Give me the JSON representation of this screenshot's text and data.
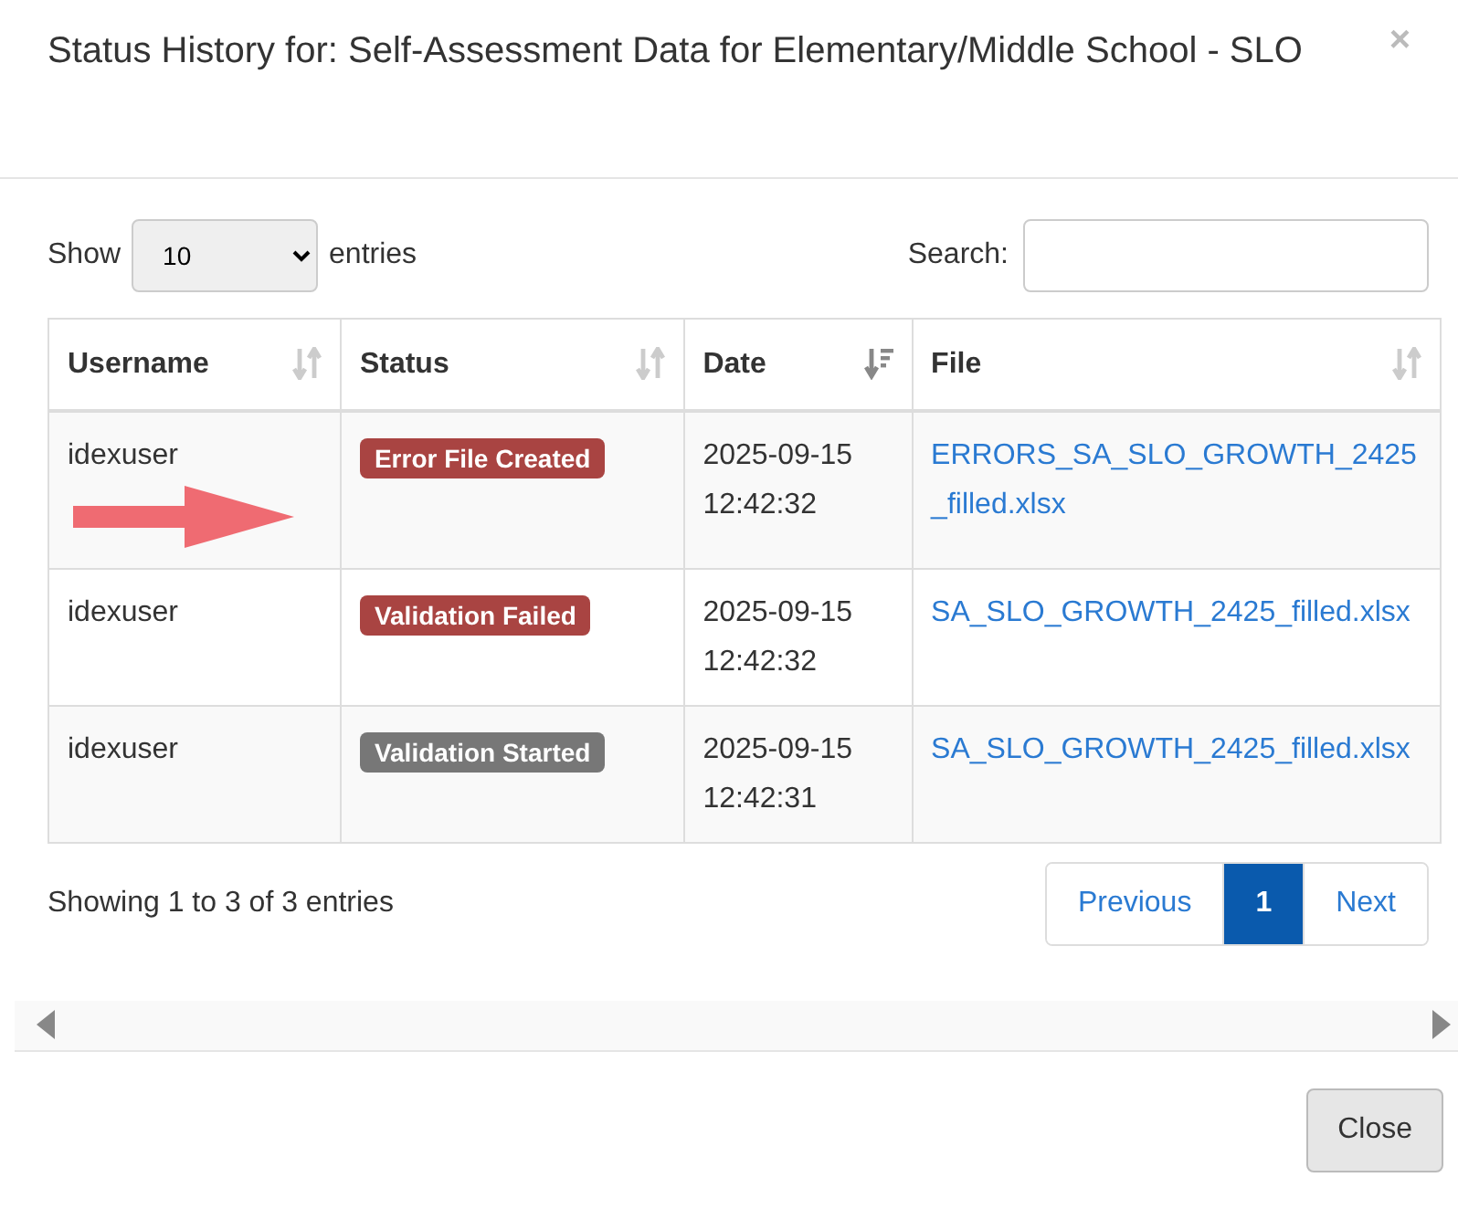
{
  "dialog": {
    "title": "Status History for: Self-Assessment Data for Elementary/Middle School - SLO",
    "close_glyph": "×"
  },
  "length": {
    "label_before": "Show",
    "value": "10",
    "label_after": "entries"
  },
  "search": {
    "label": "Search:"
  },
  "table": {
    "columns": [
      {
        "label": "Username",
        "sorted": false
      },
      {
        "label": "Status",
        "sorted": false
      },
      {
        "label": "Date",
        "sorted": true
      },
      {
        "label": "File",
        "sorted": false
      }
    ],
    "rows": [
      {
        "username": "idexuser",
        "status": "Error File Created",
        "color": "#a94442",
        "date": "2025-09-15",
        "time": "12:42:32",
        "file": "ERRORS_SA_SLO_GROWTH_2425_filled.xlsx",
        "pointer_arrow": true
      },
      {
        "username": "idexuser",
        "status": "Validation Failed",
        "color": "#a94442",
        "date": "2025-09-15",
        "time": "12:42:32",
        "file": "SA_SLO_GROWTH_2425_filled.xlsx",
        "pointer_arrow": false
      },
      {
        "username": "idexuser",
        "status": "Validation Started",
        "color": "#777777",
        "date": "2025-09-15",
        "time": "12:42:31",
        "file": "SA_SLO_GROWTH_2425_filled.xlsx",
        "pointer_arrow": false
      }
    ]
  },
  "info": "Showing 1 to 3 of 3 entries",
  "pagination": [
    {
      "label": "Previous",
      "selected": false
    },
    {
      "label": "1",
      "selected": true
    },
    {
      "label": "Next",
      "selected": false
    }
  ],
  "footer": {
    "close_button": "Close"
  }
}
